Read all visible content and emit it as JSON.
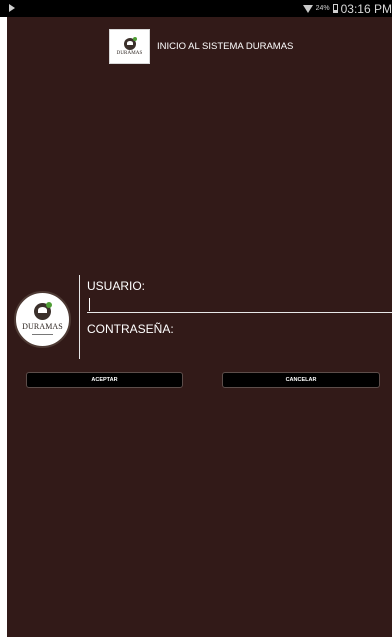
{
  "status_bar": {
    "battery_percent": "24%",
    "time": "03:16 PM"
  },
  "header": {
    "logo_text": "DURAMAS",
    "title": "INICIO AL SISTEMA DURAMAS"
  },
  "form": {
    "logo_text": "DURAMAS",
    "user_label": "USUARIO:",
    "user_value": "",
    "password_label": "CONTRASEÑA:",
    "password_value": ""
  },
  "actions": {
    "accept_label": "ACEPTAR",
    "cancel_label": "CANCELAR"
  },
  "colors": {
    "background": "#321a18",
    "button": "#000000",
    "text": "#ffffff"
  }
}
